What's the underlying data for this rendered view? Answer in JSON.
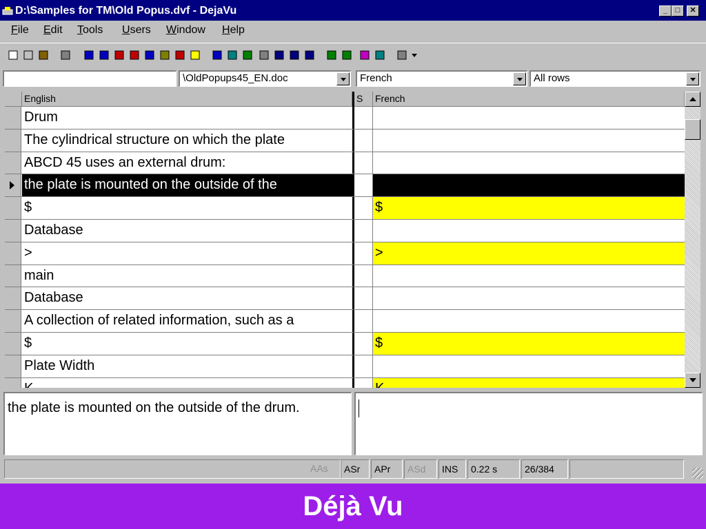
{
  "window": {
    "title": "D:\\Samples for TM\\Old Popus.dvf - DejaVu",
    "minimize": "_",
    "maximize": "□",
    "close": "✕"
  },
  "menu": [
    {
      "label": "File",
      "key": "F",
      "rest": "ile"
    },
    {
      "label": "Edit",
      "key": "E",
      "rest": "dit"
    },
    {
      "label": "Tools",
      "key": "T",
      "rest": "ools"
    },
    {
      "label": "Users",
      "key": "U",
      "rest": "sers"
    },
    {
      "label": "Window",
      "key": "W",
      "rest": "indow"
    },
    {
      "label": "Help",
      "key": "H",
      "rest": "elp"
    }
  ],
  "toolbar_icons": [
    "new-file-icon",
    "open-icon",
    "open-folder-icon",
    "properties-icon",
    "scan-icon",
    "pretranslate-icon",
    "red-shape-icon",
    "red-shape-2-icon",
    "sort-icon",
    "spellcheck-icon",
    "search-replace-icon",
    "arrow-right-icon",
    "preview-icon",
    "lexicon-icon",
    "terminology-icon",
    "list-icon",
    "find-icon",
    "arrow-up-left-icon",
    "arrow-up-left-2-icon",
    "arrow-down-icon",
    "arrow-down-2-icon",
    "book-icon",
    "export-icon",
    "settings-icon"
  ],
  "selectors": {
    "left_field": "",
    "file": "\\OldPopups45_EN.doc",
    "language": "French",
    "filter": "All rows"
  },
  "grid": {
    "columns": {
      "source": "English",
      "status": "S",
      "target": "French"
    },
    "rows": [
      {
        "source": "Drum",
        "target": "",
        "highlight": false,
        "active": false
      },
      {
        "source": "The cylindrical structure on which the plate",
        "target": "",
        "highlight": false,
        "active": false
      },
      {
        "source": "ABCD 45 uses an external drum:",
        "target": "",
        "highlight": false,
        "active": false
      },
      {
        "source": "the plate is mounted on the outside of the",
        "target": "",
        "highlight": false,
        "active": true
      },
      {
        "source": "$",
        "target": "$",
        "highlight": true,
        "active": false
      },
      {
        "source": "Database",
        "target": "",
        "highlight": false,
        "active": false
      },
      {
        "source": ">",
        "target": ">",
        "highlight": true,
        "active": false
      },
      {
        "source": "main",
        "target": "",
        "highlight": false,
        "active": false
      },
      {
        "source": "Database",
        "target": "",
        "highlight": false,
        "active": false
      },
      {
        "source": "A collection of related information, such as a",
        "target": "",
        "highlight": false,
        "active": false
      },
      {
        "source": "$",
        "target": "$",
        "highlight": true,
        "active": false
      },
      {
        "source": "Plate Width",
        "target": "",
        "highlight": false,
        "active": false
      },
      {
        "source": "K",
        "target": "K",
        "highlight": true,
        "active": false
      }
    ]
  },
  "editor": {
    "source_text": "the plate is mounted on the outside of the drum.",
    "target_text": ""
  },
  "status": {
    "aas": "AAs",
    "asr": "ASr",
    "apr": "APr",
    "asd": "ASd",
    "ins": "INS",
    "time": "0.22 s",
    "position": "26/384"
  },
  "footer": {
    "caption": "Déjà Vu"
  },
  "colors": {
    "titlebar": "#000080",
    "highlight": "#ffff00",
    "footer": "#9d1ee8"
  }
}
